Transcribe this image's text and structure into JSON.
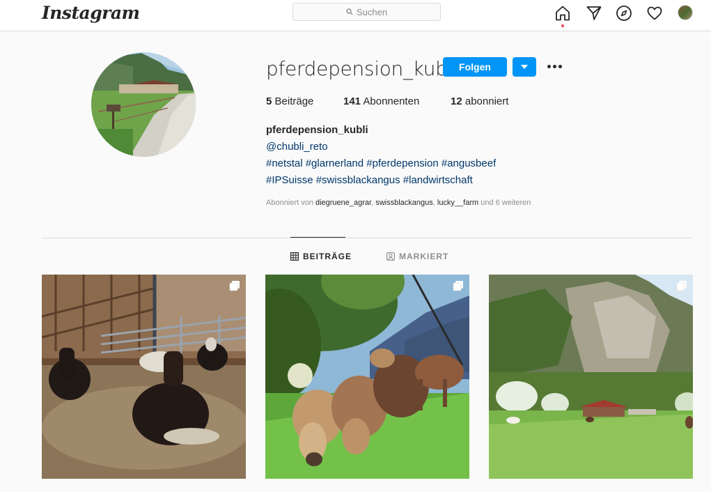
{
  "nav": {
    "logo": "Instagram",
    "search_placeholder": "Suchen",
    "icons": [
      "home-icon",
      "direct-icon",
      "explore-icon",
      "activity-heart-icon",
      "profile-avatar"
    ]
  },
  "profile": {
    "username": "pferdepension_kubli",
    "follow_label": "Folgen",
    "stats": {
      "posts_count": "5",
      "posts_label": "Beiträge",
      "followers_count": "141",
      "followers_label": "Abonnenten",
      "following_count": "12",
      "following_label": "abonniert"
    },
    "bio": {
      "name": "pferdepension_kubli",
      "mention": "@chubli_reto",
      "hashtags_line1": "#netstal #glarnerland #pferdepension #angusbeef",
      "hashtags_line2": "#IPSuisse #swissblackangus #landwirtschaft"
    },
    "followed_by": {
      "prefix": "Abonniert von",
      "account1": "diegruene_agrar",
      "account2": "swissblackangus",
      "account3": "lucky__farm",
      "suffix": "und 6 weiteren"
    }
  },
  "tabs": [
    {
      "label": "BEITRÄGE",
      "icon": "grid-icon",
      "active": true
    },
    {
      "label": "MARKIERT",
      "icon": "tagged-icon",
      "active": false
    }
  ],
  "posts": [
    {
      "subject": "horses-in-stable",
      "multi": true
    },
    {
      "subject": "cows-in-meadow",
      "multi": true
    },
    {
      "subject": "mountain-pasture-farm",
      "multi": true
    }
  ],
  "colors": {
    "accent": "#0095f6",
    "link": "#00376b",
    "muted": "#8e8e8e",
    "notification": "#ed4956"
  }
}
